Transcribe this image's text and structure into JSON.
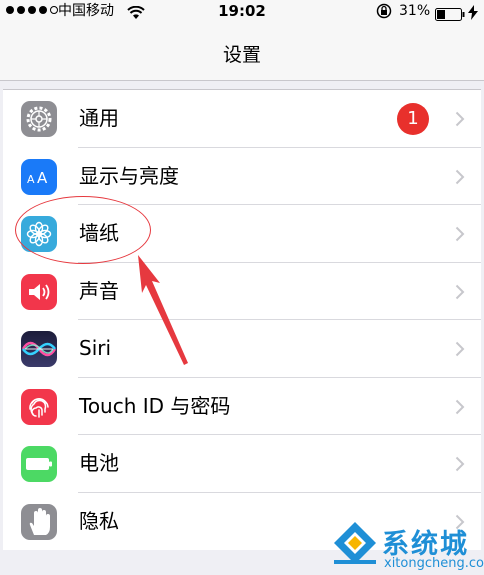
{
  "status_bar": {
    "carrier": "中国移动",
    "time": "19:02",
    "battery_percent": "31%",
    "signal_filled": 4,
    "signal_total": 5
  },
  "nav": {
    "title": "设置"
  },
  "settings_items": [
    {
      "label": "通用",
      "icon": "gear-icon",
      "color": "#8e8e93",
      "badge": "1"
    },
    {
      "label": "显示与亮度",
      "icon": "display-brightness-icon",
      "color": "#1a7af8"
    },
    {
      "label": "墙纸",
      "icon": "wallpaper-flower-icon",
      "color": "#37aadc"
    },
    {
      "label": "声音",
      "icon": "speaker-icon",
      "color": "#f2364b"
    },
    {
      "label": "Siri",
      "icon": "siri-icon",
      "color": "#2a2a44"
    },
    {
      "label": "Touch ID 与密码",
      "icon": "fingerprint-icon",
      "color": "#f2364b"
    },
    {
      "label": "电池",
      "icon": "battery-icon",
      "color": "#4cd964"
    },
    {
      "label": "隐私",
      "icon": "hand-icon",
      "color": "#8e8e93"
    }
  ],
  "annotation": {
    "highlight_color": "#e6393f"
  },
  "watermark": {
    "brand": "系统城",
    "url": "xitongcheng.com",
    "color": "#1f8fd6"
  }
}
